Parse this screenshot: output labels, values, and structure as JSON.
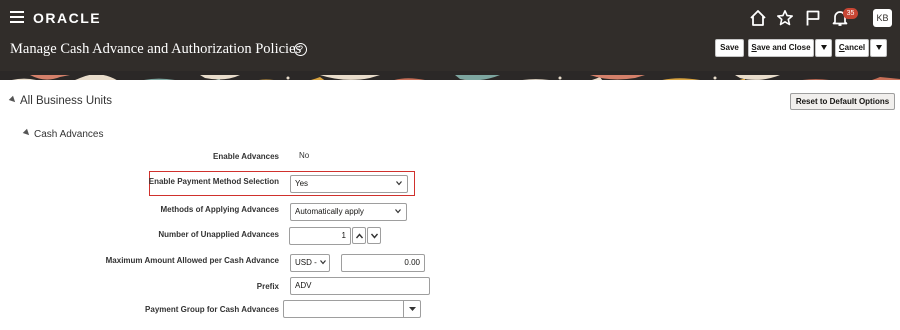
{
  "header": {
    "brand": "ORACLE",
    "notification_count": "35",
    "user_initials": "KB",
    "icons": [
      "hamburger-menu-icon",
      "home-icon",
      "star-icon",
      "flag-icon",
      "bell-icon"
    ]
  },
  "page": {
    "title": "Manage Cash Advance and Authorization Policies",
    "help_glyph": "?",
    "actions": {
      "save": "Save",
      "save_and_close_first": "S",
      "save_and_close_rest": "ave and Close",
      "cancel_first": "C",
      "cancel_rest": "ancel"
    }
  },
  "content": {
    "section_title": "All Business Units",
    "reset_button": "Reset to Default Options",
    "subsection_title": "Cash Advances",
    "fields": {
      "enable_advances": {
        "label": "Enable Advances",
        "value": "No"
      },
      "enable_payment_method": {
        "label": "Enable Payment Method Selection",
        "value": "Yes"
      },
      "methods_of_applying": {
        "label": "Methods of Applying Advances",
        "value": "Automatically apply"
      },
      "number_unapplied": {
        "label": "Number of Unapplied Advances",
        "value": "1"
      },
      "max_amount": {
        "label": "Maximum Amount Allowed per Cash Advance",
        "currency": "USD -",
        "value": "0.00"
      },
      "prefix": {
        "label": "Prefix",
        "value": "ADV"
      },
      "payment_group": {
        "label": "Payment Group for Cash Advances",
        "value": ""
      }
    }
  },
  "colors": {
    "header_bg": "#312d2a",
    "highlight_border": "#d0312d",
    "badge": "#c74634"
  }
}
